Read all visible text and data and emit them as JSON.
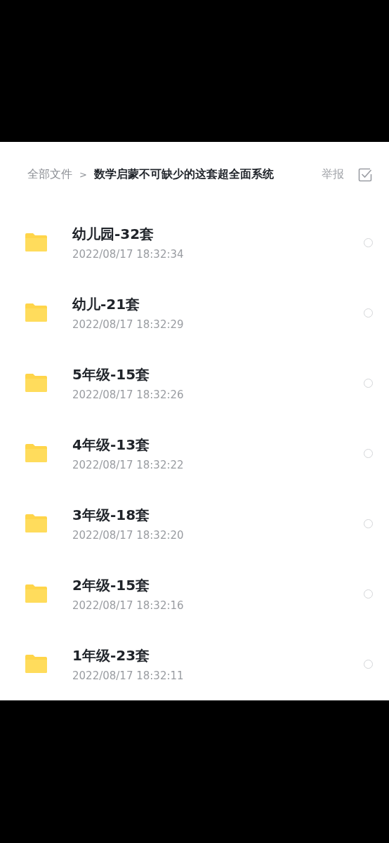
{
  "breadcrumb": {
    "root": "全部文件",
    "separator": ">",
    "current": "数学启蒙不可缺少的这套超全面系统"
  },
  "actions": {
    "report": "举报"
  },
  "files": [
    {
      "name": "幼儿园-32套",
      "date": "2022/08/17 18:32:34",
      "selected": false
    },
    {
      "name": "幼儿-21套",
      "date": "2022/08/17 18:32:29",
      "selected": false
    },
    {
      "name": "5年级-15套",
      "date": "2022/08/17 18:32:26",
      "selected": false
    },
    {
      "name": "4年级-13套",
      "date": "2022/08/17 18:32:22",
      "selected": false
    },
    {
      "name": "3年级-18套",
      "date": "2022/08/17 18:32:20",
      "selected": false
    },
    {
      "name": "2年级-15套",
      "date": "2022/08/17 18:32:16",
      "selected": false
    },
    {
      "name": "1年级-23套",
      "date": "2022/08/17 18:32:11",
      "selected": false
    }
  ]
}
